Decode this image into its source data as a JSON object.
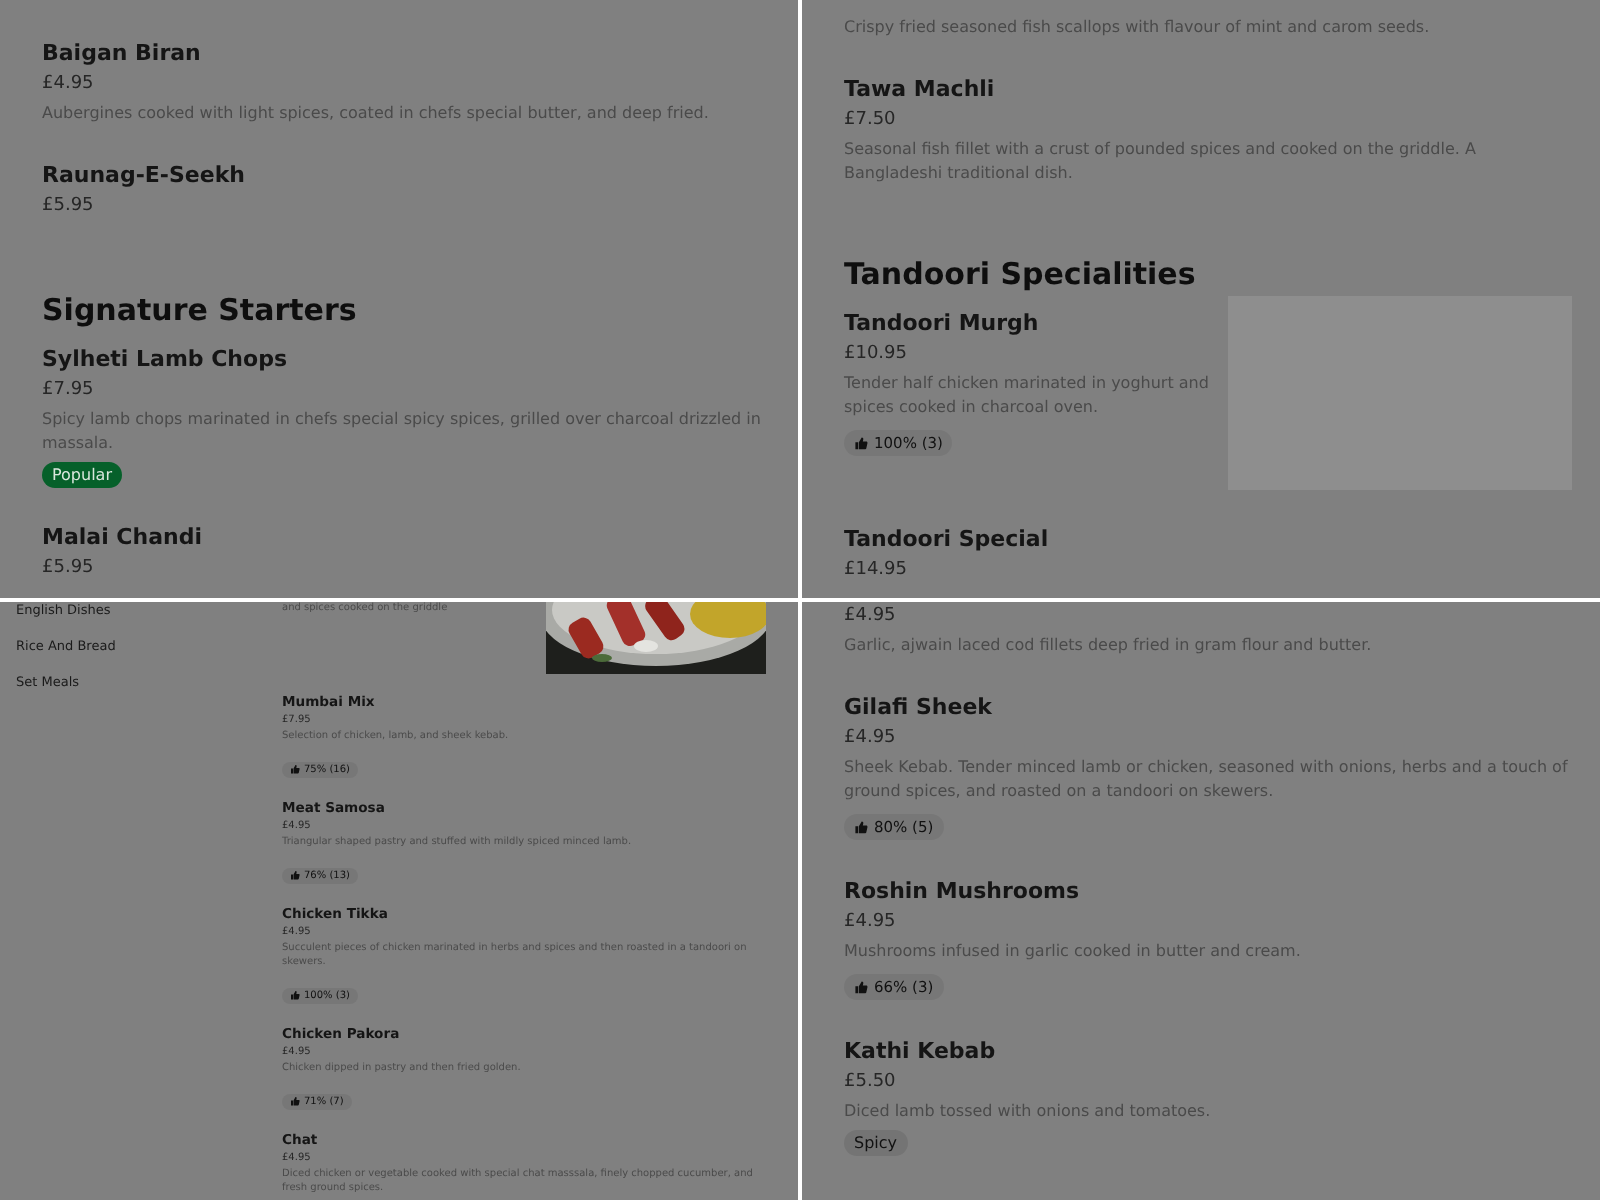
{
  "panels": [
    {
      "entries": [
        {
          "kind": "item",
          "name": "Baigan Biran",
          "price": "£4.95",
          "description": "Aubergines cooked with light spices, coated in chefs special butter, and deep fried."
        },
        {
          "kind": "item",
          "name": "Raunag-E-Seekh",
          "price": "£5.95"
        },
        {
          "kind": "heading",
          "text": "Signature Starters"
        },
        {
          "kind": "item",
          "name": "Sylheti Lamb Chops",
          "price": "£7.95",
          "description": "Spicy lamb chops marinated in chefs special spicy spices, grilled over charcoal drizzled in massala.",
          "tags": [
            {
              "label": "Popular",
              "kind": "highlight"
            }
          ]
        },
        {
          "kind": "item",
          "name": "Malai Chandi",
          "price": "£5.95"
        }
      ]
    },
    {
      "entries": [
        {
          "kind": "item",
          "description": "Crispy fried seasoned fish scallops with flavour of mint and carom seeds."
        },
        {
          "kind": "item",
          "name": "Tawa Machli",
          "price": "£7.50",
          "description": "Seasonal fish fillet with a crust of pounded spices and cooked on the griddle. A Bangladeshi traditional dish."
        },
        {
          "kind": "heading",
          "text": "Tandoori Specialities"
        },
        {
          "kind": "item",
          "name": "Tandoori Murgh",
          "price": "£10.95",
          "description": "Tender half chicken marinated in yoghurt and spices cooked in charcoal oven.",
          "rating": "100% (3)",
          "image": {
            "kind": "placeholder"
          }
        },
        {
          "kind": "item",
          "name": "Tandoori Special",
          "price": "£14.95"
        }
      ]
    },
    {
      "sidebar": {
        "items": [
          "English Dishes",
          "Rice And Bread",
          "Set Meals"
        ]
      },
      "entries": [
        {
          "kind": "item",
          "description": "and spices cooked on the griddle"
        },
        {
          "kind": "item",
          "name": "Mumbai Mix",
          "price": "£7.95",
          "description": "Selection of chicken, lamb, and sheek kebab.",
          "rating": "75% (16)"
        },
        {
          "kind": "item",
          "name": "Meat Samosa",
          "price": "£4.95",
          "description": "Triangular shaped pastry and stuffed with mildly spiced minced lamb.",
          "rating": "76% (13)"
        },
        {
          "kind": "item",
          "name": "Chicken Tikka",
          "price": "£4.95",
          "description": "Succulent pieces of chicken marinated in herbs and spices and then roasted in a tandoori on skewers.",
          "rating": "100% (3)"
        },
        {
          "kind": "item",
          "name": "Chicken Pakora",
          "price": "£4.95",
          "description": "Chicken dipped in pastry and then fried golden.",
          "rating": "71% (7)"
        },
        {
          "kind": "item",
          "name": "Chat",
          "price": "£4.95",
          "description": "Diced chicken or vegetable cooked with special chat masssala, finely chopped cucumber, and fresh ground spices."
        }
      ]
    },
    {
      "entries": [
        {
          "kind": "item",
          "price": "£4.95",
          "description": "Garlic, ajwain laced cod fillets deep fried in gram flour and butter."
        },
        {
          "kind": "item",
          "name": "Gilafi Sheek",
          "price": "£4.95",
          "description": "Sheek Kebab. Tender minced lamb or chicken, seasoned with onions, herbs and a touch of ground spices, and roasted on a tandoori on skewers.",
          "rating": "80% (5)"
        },
        {
          "kind": "item",
          "name": "Roshin Mushrooms",
          "price": "£4.95",
          "description": "Mushrooms infused in garlic cooked in butter and cream.",
          "rating": "66% (3)"
        },
        {
          "kind": "item",
          "name": "Kathi Kebab",
          "price": "£5.50",
          "description": "Diced lamb tossed with onions and tomatoes.",
          "tags": [
            {
              "label": "Spicy",
              "kind": "plain"
            }
          ]
        }
      ]
    }
  ]
}
